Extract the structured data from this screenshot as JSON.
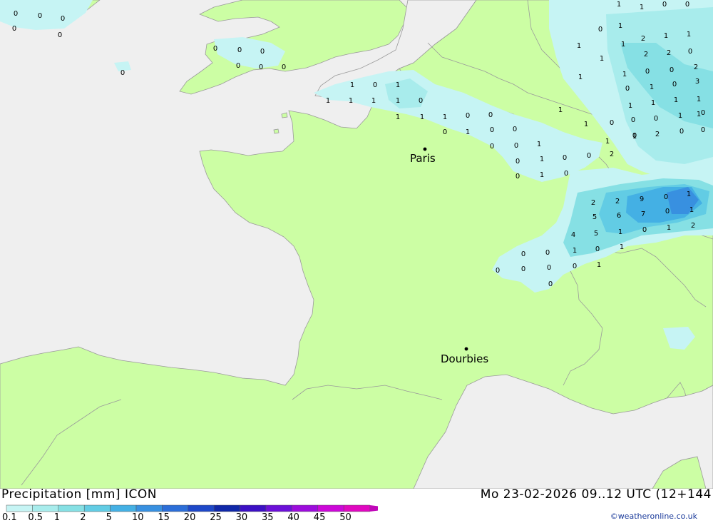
{
  "title": "Precipitation [mm] ICON",
  "valid_time": "Mo 23-02-2026 09..12 UTC (12+144",
  "credit": "©weatheronline.co.uk",
  "cities": [
    {
      "name": "Paris"
    },
    {
      "name": "Dourbies"
    }
  ],
  "colors": {
    "sea": "#efefef",
    "land": "#ccfea4",
    "border": "#9a9a9a"
  },
  "legend": {
    "ticks": [
      "0.1",
      "0.5",
      "1",
      "2",
      "5",
      "10",
      "15",
      "20",
      "25",
      "30",
      "35",
      "40",
      "45",
      "50"
    ],
    "colors": [
      "#c6f4f4",
      "#a8ecec",
      "#86e0e4",
      "#62cce4",
      "#44b0e4",
      "#3890e0",
      "#2c6ed8",
      "#1e48c8",
      "#1028a8",
      "#3c10c4",
      "#6c10d8",
      "#9c0cdc",
      "#cc08d8",
      "#e008c0"
    ]
  },
  "precip_labels": [
    {
      "t": "0"
    },
    {
      "t": "0"
    },
    {
      "t": "0"
    },
    {
      "t": "0"
    },
    {
      "t": "0"
    },
    {
      "t": "0"
    },
    {
      "t": "0"
    },
    {
      "t": "0"
    },
    {
      "t": "0"
    },
    {
      "t": "0"
    },
    {
      "t": "0"
    },
    {
      "t": "0"
    },
    {
      "t": "1"
    },
    {
      "t": "0"
    },
    {
      "t": "1"
    },
    {
      "t": "1"
    },
    {
      "t": "1"
    },
    {
      "t": "1"
    },
    {
      "t": "1"
    },
    {
      "t": "0"
    },
    {
      "t": "1"
    },
    {
      "t": "1"
    },
    {
      "t": "1"
    },
    {
      "t": "0"
    },
    {
      "t": "0"
    },
    {
      "t": "0"
    },
    {
      "t": "1"
    },
    {
      "t": "0"
    },
    {
      "t": "0"
    },
    {
      "t": "0"
    },
    {
      "t": "0"
    },
    {
      "t": "1"
    },
    {
      "t": "0"
    },
    {
      "t": "1"
    },
    {
      "t": "0"
    },
    {
      "t": "0"
    },
    {
      "t": "0"
    },
    {
      "t": "1"
    },
    {
      "t": "0"
    },
    {
      "t": "1"
    },
    {
      "t": "1"
    },
    {
      "t": "2"
    },
    {
      "t": "1"
    },
    {
      "t": "1"
    },
    {
      "t": "0"
    },
    {
      "t": "0"
    },
    {
      "t": "1"
    },
    {
      "t": "2"
    },
    {
      "t": "1"
    },
    {
      "t": "1"
    },
    {
      "t": "0"
    },
    {
      "t": "1"
    },
    {
      "t": "2"
    },
    {
      "t": "2"
    },
    {
      "t": "0"
    },
    {
      "t": "1"
    },
    {
      "t": "1"
    },
    {
      "t": "1"
    },
    {
      "t": "0"
    },
    {
      "t": "0"
    },
    {
      "t": "2"
    },
    {
      "t": "0"
    },
    {
      "t": "1"
    },
    {
      "t": "0"
    },
    {
      "t": "3"
    },
    {
      "t": "1"
    },
    {
      "t": "1"
    },
    {
      "t": "1"
    },
    {
      "t": "1"
    },
    {
      "t": "1"
    },
    {
      "t": "0"
    },
    {
      "t": "0"
    },
    {
      "t": "1"
    },
    {
      "t": "0"
    },
    {
      "t": "0"
    },
    {
      "t": "1"
    },
    {
      "t": "0"
    },
    {
      "t": "2"
    },
    {
      "t": "0"
    },
    {
      "t": "0"
    },
    {
      "t": "1"
    },
    {
      "t": "1"
    },
    {
      "t": "2"
    },
    {
      "t": "2"
    },
    {
      "t": "9"
    },
    {
      "t": "0"
    },
    {
      "t": "1"
    },
    {
      "t": "5"
    },
    {
      "t": "6"
    },
    {
      "t": "7"
    },
    {
      "t": "0"
    },
    {
      "t": "1"
    },
    {
      "t": "4"
    },
    {
      "t": "5"
    },
    {
      "t": "1"
    },
    {
      "t": "0"
    },
    {
      "t": "1"
    },
    {
      "t": "2"
    },
    {
      "t": "1"
    },
    {
      "t": "0"
    },
    {
      "t": "1"
    },
    {
      "t": "0"
    },
    {
      "t": "0"
    },
    {
      "t": "0"
    },
    {
      "t": "0"
    },
    {
      "t": "0"
    },
    {
      "t": "0"
    },
    {
      "t": "1"
    },
    {
      "t": "0"
    }
  ]
}
